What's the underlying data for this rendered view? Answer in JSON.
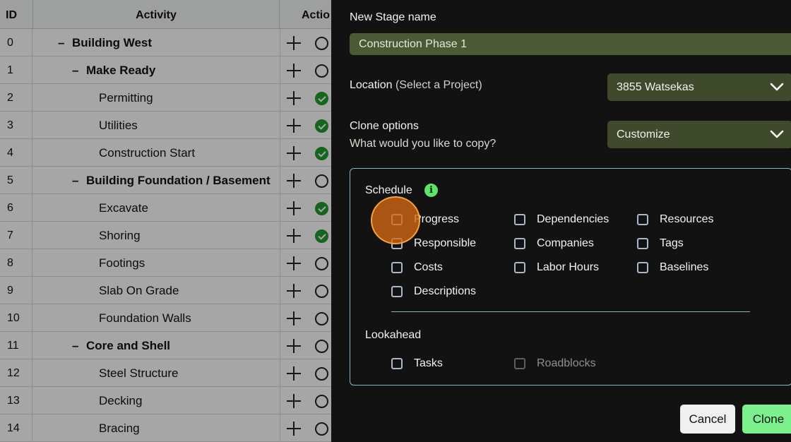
{
  "table": {
    "headers": {
      "id": "ID",
      "activity": "Activity",
      "action": "Actio"
    },
    "rows": [
      {
        "id": "0",
        "name": "Building West",
        "level": 0,
        "group": true,
        "done": false
      },
      {
        "id": "1",
        "name": "Make Ready",
        "level": 1,
        "group": true,
        "done": false
      },
      {
        "id": "2",
        "name": "Permitting",
        "level": 2,
        "group": false,
        "done": true
      },
      {
        "id": "3",
        "name": "Utilities",
        "level": 2,
        "group": false,
        "done": true
      },
      {
        "id": "4",
        "name": "Construction Start",
        "level": 2,
        "group": false,
        "done": true
      },
      {
        "id": "5",
        "name": "Building Foundation / Basement",
        "level": 1,
        "group": true,
        "done": false
      },
      {
        "id": "6",
        "name": "Excavate",
        "level": 2,
        "group": false,
        "done": true
      },
      {
        "id": "7",
        "name": "Shoring",
        "level": 2,
        "group": false,
        "done": true
      },
      {
        "id": "8",
        "name": "Footings",
        "level": 2,
        "group": false,
        "done": false
      },
      {
        "id": "9",
        "name": "Slab On Grade",
        "level": 2,
        "group": false,
        "done": false
      },
      {
        "id": "10",
        "name": "Foundation Walls",
        "level": 2,
        "group": false,
        "done": false
      },
      {
        "id": "11",
        "name": "Core and Shell",
        "level": 1,
        "group": true,
        "done": false
      },
      {
        "id": "12",
        "name": "Steel Structure",
        "level": 2,
        "group": false,
        "done": false
      },
      {
        "id": "13",
        "name": "Decking",
        "level": 2,
        "group": false,
        "done": false
      },
      {
        "id": "14",
        "name": "Bracing",
        "level": 2,
        "group": false,
        "done": false
      }
    ],
    "collapse_symbol": "–"
  },
  "dialog": {
    "stage_name_label": "New Stage name",
    "stage_name_value": "Construction Phase 1",
    "location_label": "Location",
    "location_hint": "(Select a Project)",
    "location_value": "3855 Watsekas",
    "clone_options_label": "Clone options",
    "clone_options_sub": "What would you like to copy?",
    "clone_options_value": "Customize",
    "schedule_title": "Schedule",
    "info_icon": "i",
    "schedule_options": [
      {
        "label": "Progress",
        "checked": false,
        "disabled": false
      },
      {
        "label": "Dependencies",
        "checked": false,
        "disabled": false
      },
      {
        "label": "Resources",
        "checked": false,
        "disabled": false
      },
      {
        "label": "Responsible",
        "checked": false,
        "disabled": false
      },
      {
        "label": "Companies",
        "checked": false,
        "disabled": false
      },
      {
        "label": "Tags",
        "checked": false,
        "disabled": false
      },
      {
        "label": "Costs",
        "checked": false,
        "disabled": false
      },
      {
        "label": "Labor Hours",
        "checked": false,
        "disabled": false
      },
      {
        "label": "Baselines",
        "checked": false,
        "disabled": false
      },
      {
        "label": "Descriptions",
        "checked": false,
        "disabled": false
      }
    ],
    "lookahead_title": "Lookahead",
    "lookahead_options": [
      {
        "label": "Tasks",
        "checked": false,
        "disabled": false
      },
      {
        "label": "Roadblocks",
        "checked": false,
        "disabled": true
      }
    ],
    "cancel_label": "Cancel",
    "clone_label": "Clone"
  },
  "colors": {
    "input_bg": "#4b5a34",
    "select_bg": "#3e4a2b",
    "clone_button": "#7cf08c",
    "done_check": "#1f9c2d",
    "cursor_highlight": "#d66816"
  }
}
